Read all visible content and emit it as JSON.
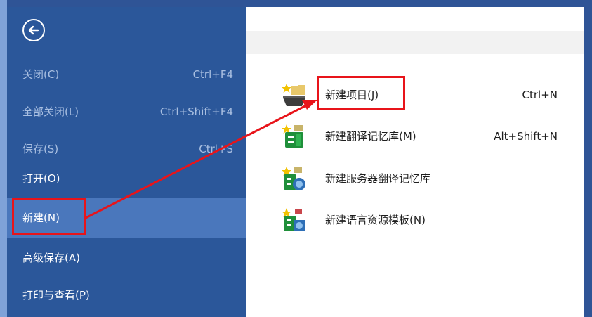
{
  "sidebar": {
    "back_icon": "arrow-left-circle-icon",
    "items": [
      {
        "label": "关闭(C)",
        "shortcut": "Ctrl+F4"
      },
      {
        "label": "全部关闭(L)",
        "shortcut": "Ctrl+Shift+F4"
      },
      {
        "label": "保存(S)",
        "shortcut": "Ctrl+S"
      },
      {
        "label": "打开(O)",
        "shortcut": ""
      },
      {
        "label": "新建(N)",
        "shortcut": ""
      },
      {
        "label": "高级保存(A)",
        "shortcut": ""
      },
      {
        "label": "打印与查看(P)",
        "shortcut": ""
      }
    ]
  },
  "new_menu": {
    "items": [
      {
        "label": "新建项目(J)",
        "shortcut": "Ctrl+N",
        "icon": "new-project-icon"
      },
      {
        "label": "新建翻译记忆库(M)",
        "shortcut": "Alt+Shift+N",
        "icon": "new-translation-memory-icon"
      },
      {
        "label": "新建服务器翻译记忆库",
        "shortcut": "",
        "icon": "new-server-translation-memory-icon"
      },
      {
        "label": "新建语言资源模板(N)",
        "shortcut": "",
        "icon": "new-language-resource-template-icon"
      }
    ]
  },
  "colors": {
    "sidebar_bg": "#2b579a",
    "sidebar_selected": "#4a77bc",
    "annotation_red": "#e8141a"
  }
}
